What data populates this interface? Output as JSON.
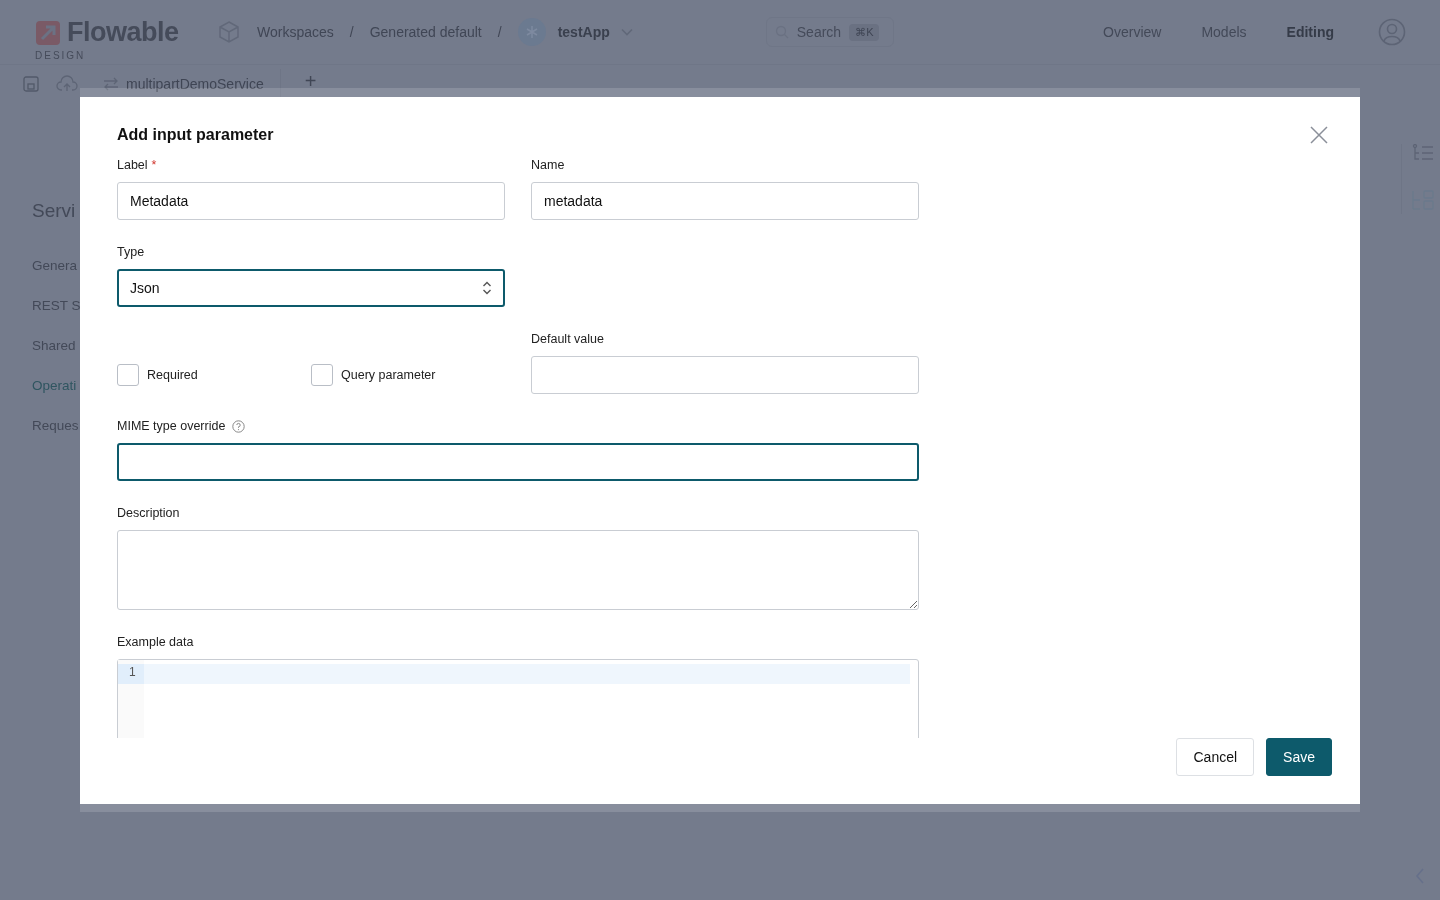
{
  "header": {
    "logo": "Flowable",
    "logo_sub": "DESIGN",
    "breadcrumbs": [
      "Workspaces",
      "Generated default"
    ],
    "separator": "/",
    "app": "testApp",
    "search": {
      "placeholder": "Search",
      "shortcut": "⌘K"
    },
    "nav": [
      {
        "label": "Overview",
        "selected": false
      },
      {
        "label": "Models",
        "selected": false
      },
      {
        "label": "Editing",
        "selected": true
      }
    ]
  },
  "tab_bar": {
    "tabs": [
      {
        "label": "multipartDemoService"
      }
    ],
    "add": "+"
  },
  "side": {
    "title": "Servi",
    "items": [
      {
        "label": "Genera",
        "selected": false
      },
      {
        "label": "REST S",
        "selected": false
      },
      {
        "label": "Shared",
        "selected": false
      },
      {
        "label": "Operati",
        "selected": true
      },
      {
        "label": "Reques",
        "selected": false
      }
    ]
  },
  "dialog": {
    "title": "Add input parameter",
    "required_mark": "*",
    "label": {
      "label": "Label",
      "required": true,
      "value": "Metadata",
      "focused": false
    },
    "name": {
      "label": "Name",
      "required": false,
      "value": "metadata",
      "focused": false
    },
    "type": {
      "label": "Type",
      "value": "Json",
      "focused": true
    },
    "checkboxes": [
      {
        "label": "Required",
        "checked": false
      },
      {
        "label": "Query parameter",
        "checked": false
      }
    ],
    "default_value": {
      "label": "Default value",
      "focused": false
    },
    "mime": {
      "label": "MIME type override",
      "focused": true
    },
    "description": {
      "label": "Description"
    },
    "example": {
      "label": "Example data",
      "line_numbers": [
        "1"
      ]
    },
    "buttons": {
      "cancel": "Cancel",
      "save": "Save"
    }
  }
}
